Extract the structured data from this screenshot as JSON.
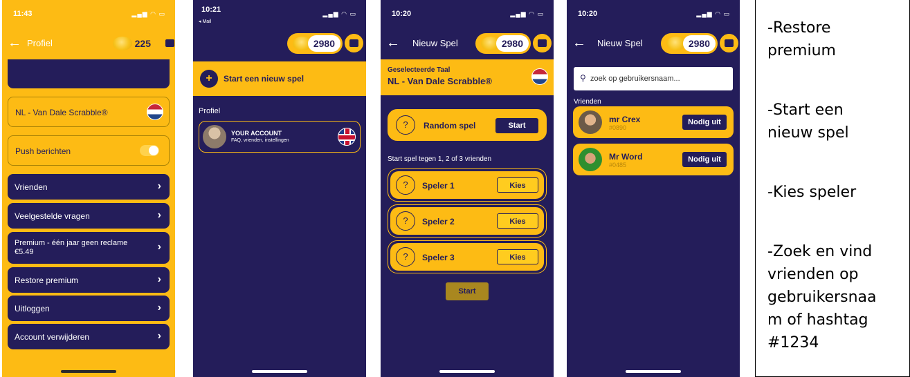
{
  "screen1": {
    "time": "11:43",
    "status_icons": "▂▄▆ ◠ ▭",
    "title": "Profiel",
    "coins": "225",
    "language": "NL - Van Dale Scrabble®",
    "push_label": "Push berichten",
    "menu": [
      {
        "label": "Vrienden"
      },
      {
        "label": "Veelgestelde vragen"
      },
      {
        "label": "Premium - één jaar geen reclame",
        "sub": "€5.49"
      },
      {
        "label": "Restore premium"
      },
      {
        "label": "Uitloggen"
      },
      {
        "label": "Account verwijderen"
      }
    ]
  },
  "screen2": {
    "time": "10:21",
    "back_app": "◂ Mail",
    "status_icons": "▂▄▆ ◠ ▭",
    "coins": "2980",
    "new_game": "Start een nieuw spel",
    "section": "Profiel",
    "account_title": "YOUR ACCOUNT",
    "account_sub": "FAQ, vrienden, instellingen"
  },
  "screen3": {
    "time": "10:20",
    "status_icons": "▂▄▆ ◠ ▭",
    "title": "Nieuw Spel",
    "coins": "2980",
    "selected_lang_label": "Geselecteerde Taal",
    "selected_lang": "NL - Van Dale Scrabble®",
    "random_label": "Random spel",
    "random_button": "Start",
    "friends_prompt": "Start spel tegen 1, 2 of 3 vrienden",
    "players": [
      {
        "label": "Speler 1",
        "button": "Kies"
      },
      {
        "label": "Speler 2",
        "button": "Kies"
      },
      {
        "label": "Speler 3",
        "button": "Kies"
      }
    ],
    "start_button": "Start"
  },
  "screen4": {
    "time": "10:20",
    "status_icons": "▂▄▆ ◠ ▭",
    "title": "Nieuw Spel",
    "coins": "2980",
    "search_placeholder": "zoek op gebruikersnaam...",
    "friends_label": "Vrienden",
    "friends": [
      {
        "name": "mr Crex",
        "tag": "#0890",
        "button": "Nodig uit"
      },
      {
        "name": "Mr Word",
        "tag": "#0485",
        "button": "Nodig uit"
      }
    ]
  },
  "notes": [
    "-Restore",
    "premium",
    "-Start een",
    "nieuw spel",
    "-Kies speler",
    "-Zoek en vind",
    "vrienden op",
    "gebruikersnaa",
    "m of hashtag",
    "#1234"
  ],
  "colors": {
    "navy": "#241d5a",
    "yellow": "#fdbb14"
  }
}
